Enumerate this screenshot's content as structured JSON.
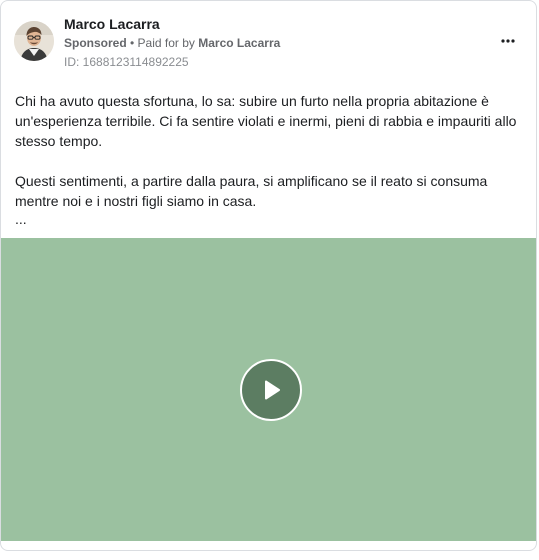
{
  "post": {
    "author_name": "Marco Lacarra",
    "sponsored_label": "Sponsored",
    "paid_for_prefix": " • Paid for by ",
    "payer_name": "Marco Lacarra",
    "ad_id": "ID: 1688123114892225",
    "paragraph_1": "Chi ha avuto questa sfortuna, lo sa: subire un furto nella propria abitazione è un'esperienza terribile. Ci fa sentire violati e inermi, pieni di rabbia e impauriti allo stesso tempo.",
    "paragraph_2": "Questi sentimenti, a partire dalla paura, si amplificano se il reato si consuma mentre noi e i nostri figli siamo in casa.",
    "ellipsis": "..."
  },
  "icons": {
    "more": "more-options-icon",
    "play": "play-icon",
    "avatar": "profile-photo"
  },
  "colors": {
    "video_background": "#9bc1a0",
    "play_button": "#5c7d62"
  }
}
